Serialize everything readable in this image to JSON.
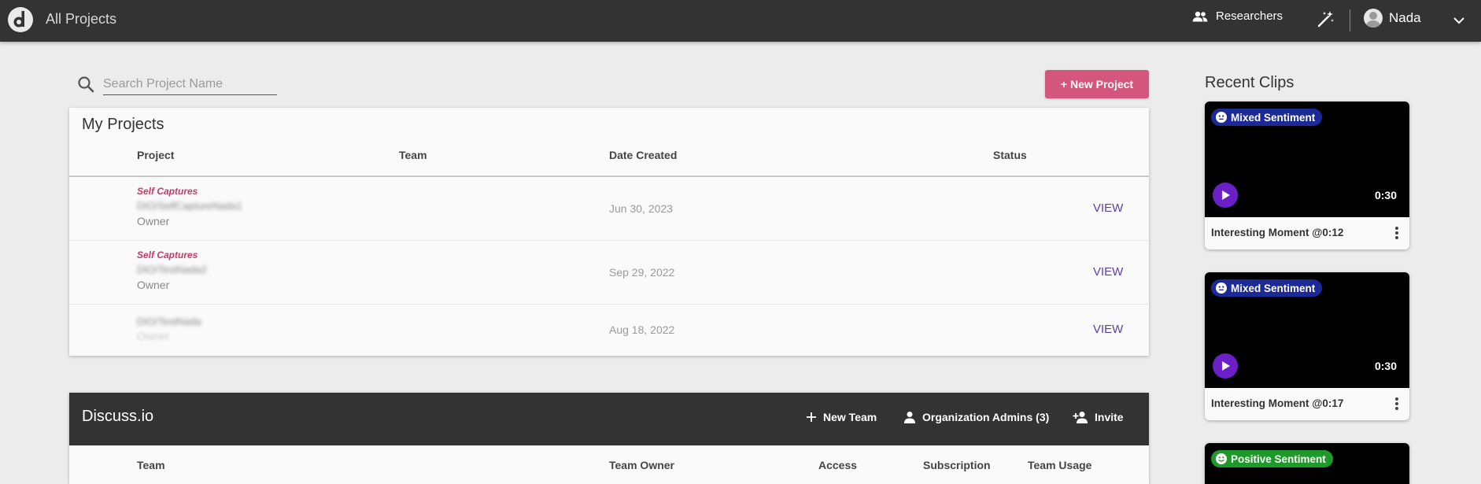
{
  "topbar": {
    "title": "All Projects",
    "researchers_label": "Researchers",
    "user_name": "Nada",
    "icons": {
      "logo": "discuss-logo-icon",
      "researchers": "people-icon",
      "magic": "magic-wand-icon",
      "menu": "chevron-down-icon"
    }
  },
  "search": {
    "placeholder": "Search Project Name",
    "value": ""
  },
  "actions": {
    "new_project_label": "+ New Project"
  },
  "projects": {
    "title": "My Projects",
    "columns": [
      "Project",
      "Team",
      "Date Created",
      "Status"
    ],
    "rows": [
      {
        "type": "Self Captures",
        "name": "DIO/SelfCaptureNada1",
        "role": "Owner",
        "date": "Jun 30, 2023",
        "action": "VIEW"
      },
      {
        "type": "Self Captures",
        "name": "DIO/TestNada2",
        "role": "Owner",
        "date": "Sep 29, 2022",
        "action": "VIEW"
      },
      {
        "type": "",
        "name": "DIO/TestNada",
        "role": "Owner",
        "date": "Aug 18, 2022",
        "action": "VIEW"
      }
    ]
  },
  "organization": {
    "name": "Discuss.io",
    "new_team_label": "New Team",
    "admins_label": "Organization Admins (3)",
    "invite_label": "Invite",
    "columns": [
      "Team",
      "Team Owner",
      "Access",
      "Subscription",
      "Team Usage"
    ]
  },
  "recent_clips": {
    "title": "Recent Clips",
    "clips": [
      {
        "sentiment": "Mixed Sentiment",
        "sentiment_color": "#1b2a96",
        "duration": "0:30",
        "label": "Interesting Moment @0:12"
      },
      {
        "sentiment": "Mixed Sentiment",
        "sentiment_color": "#1b2a96",
        "duration": "0:30",
        "label": "Interesting Moment @0:17"
      },
      {
        "sentiment": "Positive Sentiment",
        "sentiment_color": "#1e9a2a",
        "duration": "",
        "label": ""
      }
    ]
  },
  "colors": {
    "topbar": "#333333",
    "accent_pink": "#d4567f",
    "link_purple": "#5b3fa8",
    "play_purple": "#6a1fc7"
  }
}
